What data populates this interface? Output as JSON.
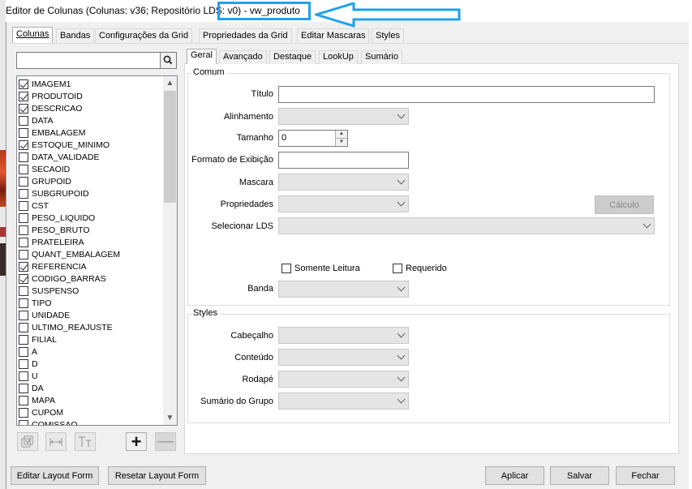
{
  "window": {
    "title": "Editor de Colunas (Colunas: v36; Repositório LDS: v0) - vw_produto"
  },
  "main_tabs": [
    {
      "label": "Colunas",
      "active": true
    },
    {
      "label": "Bandas"
    },
    {
      "label": "Configurações da Grid"
    },
    {
      "label": "Propriedades da Grid"
    },
    {
      "label": "Editar Mascaras"
    },
    {
      "label": "Styles"
    }
  ],
  "columns_panel": {
    "search_value": "",
    "search_icon": "magnifier-icon",
    "items": [
      {
        "label": "IMAGEM1",
        "checked": true
      },
      {
        "label": "PRODUTOID",
        "checked": true
      },
      {
        "label": "DESCRICAO",
        "checked": true
      },
      {
        "label": "DATA",
        "checked": false
      },
      {
        "label": "EMBALAGEM",
        "checked": false
      },
      {
        "label": "ESTOQUE_MINIMO",
        "checked": true
      },
      {
        "label": "DATA_VALIDADE",
        "checked": false
      },
      {
        "label": "SECAOID",
        "checked": false
      },
      {
        "label": "GRUPOID",
        "checked": false
      },
      {
        "label": "SUBGRUPOID",
        "checked": false
      },
      {
        "label": "CST",
        "checked": false
      },
      {
        "label": "PESO_LIQUIDO",
        "checked": false
      },
      {
        "label": "PESO_BRUTO",
        "checked": false
      },
      {
        "label": "PRATELEIRA",
        "checked": false
      },
      {
        "label": "QUANT_EMBALAGEM",
        "checked": false
      },
      {
        "label": "REFERENCIA",
        "checked": true
      },
      {
        "label": "CODIGO_BARRAS",
        "checked": true
      },
      {
        "label": "SUSPENSO",
        "checked": false
      },
      {
        "label": "TIPO",
        "checked": false
      },
      {
        "label": "UNIDADE",
        "checked": false
      },
      {
        "label": "ULTIMO_REAJUSTE",
        "checked": false
      },
      {
        "label": "FILIAL",
        "checked": false
      },
      {
        "label": "A",
        "checked": false
      },
      {
        "label": "D",
        "checked": false
      },
      {
        "label": "U",
        "checked": false
      },
      {
        "label": "DA",
        "checked": false
      },
      {
        "label": "MAPA",
        "checked": false
      },
      {
        "label": "CUPOM",
        "checked": false
      },
      {
        "label": "COMISSAO",
        "checked": false
      }
    ]
  },
  "inner_tabs": [
    {
      "label": "Geral",
      "active": true
    },
    {
      "label": "Avançado"
    },
    {
      "label": "Destaque"
    },
    {
      "label": "LookUp"
    },
    {
      "label": "Sumário"
    }
  ],
  "comum": {
    "group_title": "Comum",
    "titulo_label": "Título",
    "titulo_value": "",
    "alinhamento_label": "Alinhamento",
    "tamanho_label": "Tamanho",
    "tamanho_value": "0",
    "formato_label": "Formato de Exibição",
    "formato_value": "",
    "mascara_label": "Mascara",
    "propriedades_label": "Propriedades",
    "calculo_button": "Cálculo",
    "selecionar_lds_label": "Selecionar LDS",
    "somente_leitura_label": "Somente Leitura",
    "somente_leitura_checked": false,
    "requerido_label": "Requerido",
    "requerido_checked": false,
    "banda_label": "Banda"
  },
  "styles": {
    "group_title": "Styles",
    "cabecalho_label": "Cabeçalho",
    "conteudo_label": "Conteúdo",
    "rodape_label": "Rodapé",
    "sumario_grupo_label": "Sumário do Grupo"
  },
  "footer": {
    "editar_layout": "Editar Layout Form",
    "resetar_layout": "Resetar Layout Form",
    "aplicar": "Aplicar",
    "salvar": "Salvar",
    "fechar": "Fechar"
  },
  "colors": {
    "highlight_annotation": "#1ea1ee"
  }
}
